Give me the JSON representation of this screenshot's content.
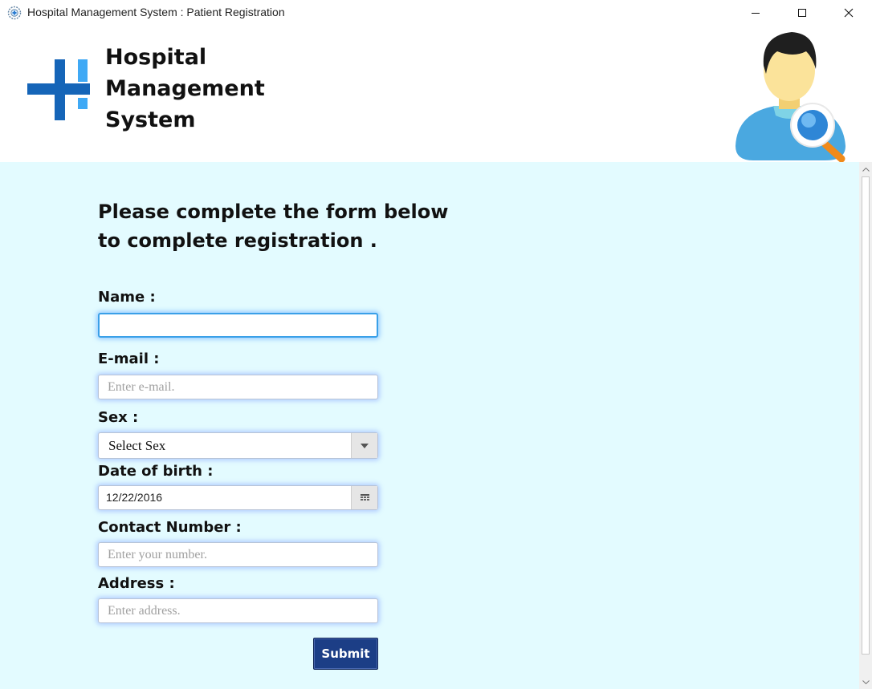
{
  "window": {
    "title": "Hospital Management System : Patient Registration",
    "icons": {
      "app": "hospital-gear-icon",
      "minimize": "minimize-icon",
      "maximize": "maximize-icon",
      "close": "close-icon"
    }
  },
  "header": {
    "brand_line1": "Hospital",
    "brand_line2": "Management",
    "brand_line3": "System",
    "logo_icon": "hospital-cross-logo",
    "avatar_icon": "patient-search-icon",
    "colors": {
      "logo_dark": "#1565b8",
      "logo_light": "#3fa9f5"
    }
  },
  "form": {
    "heading_line1": "Please complete the form below",
    "heading_line2": "to complete registration .",
    "name_label": "Name :",
    "name_value": "",
    "email_label": "E-mail :",
    "email_placeholder": "Enter e-mail.",
    "sex_label": "Sex :",
    "sex_value": "Select Sex",
    "dob_label": "Date of birth :",
    "dob_value": "12/22/2016",
    "contact_label": "Contact Number :",
    "contact_placeholder": "Enter your number.",
    "address_label": "Address :",
    "address_placeholder": "Enter address.",
    "submit_label": "Submit"
  },
  "colors": {
    "content_bg": "#e3fbff",
    "submit_bg": "#1c3e86",
    "focus_border": "#3aa0e8"
  }
}
